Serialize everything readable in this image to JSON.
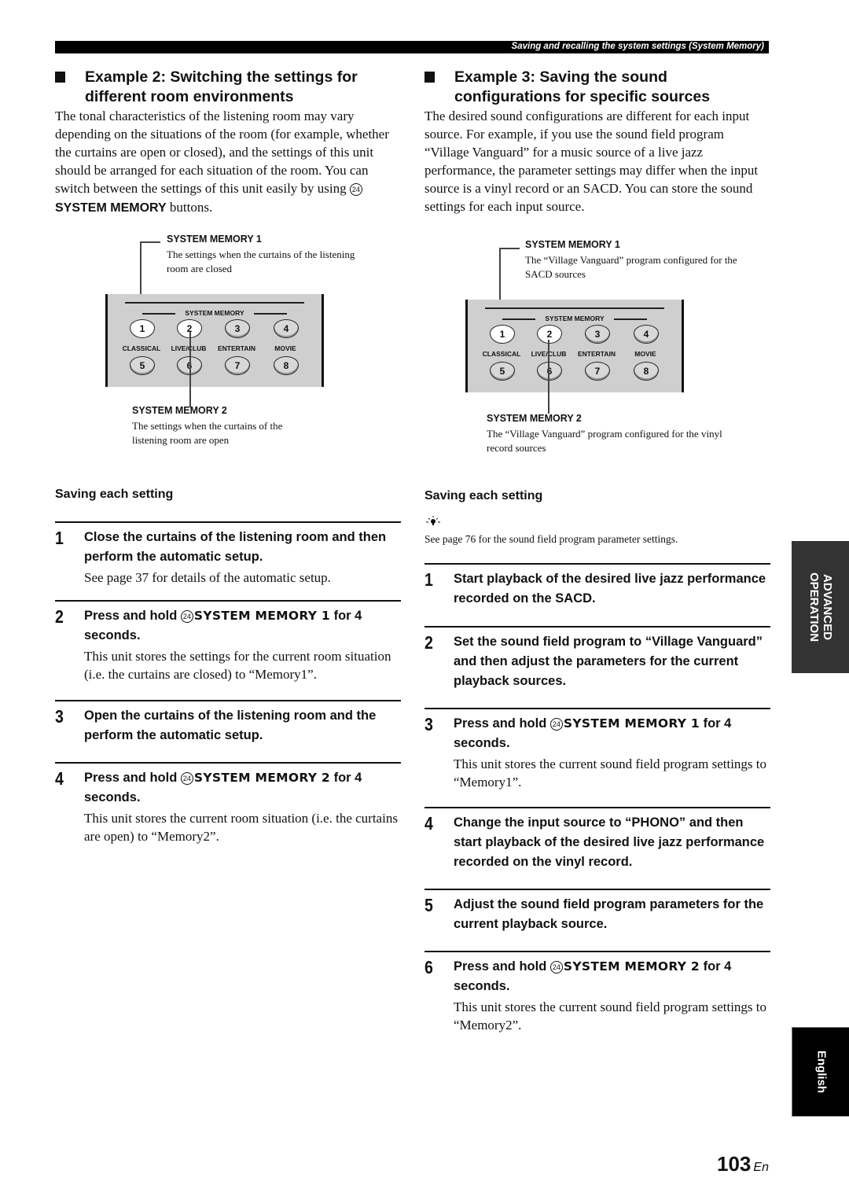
{
  "header": {
    "title": "Saving and recalling the system settings (System Memory)"
  },
  "left": {
    "heading_line1": "Example 2: Switching the settings for",
    "heading_line2": "different room environments",
    "intro_text": "The tonal characteristics of the listening room may vary depending on the situations of the room (for example, whether the curtains are open or closed), and the settings of this unit should be arranged for each situation of the room. You can switch between the settings of this unit easily by using ",
    "intro_button_ref": "24",
    "intro_bold": "SYSTEM MEMORY",
    "intro_tail": " buttons.",
    "diagram": {
      "callout1_title": "SYSTEM MEMORY 1",
      "callout1_desc": "The settings when the curtains of the listening room are closed",
      "callout2_title": "SYSTEM MEMORY 2",
      "callout2_desc": "The settings when the curtains of the listening room are open"
    },
    "subheading": "Saving each setting",
    "steps": [
      {
        "num": "1",
        "title": "Close the curtains of the listening room and then perform the automatic setup.",
        "body": "See page 37 for details of the automatic setup."
      },
      {
        "num": "2",
        "title_pre": "Press and hold ",
        "ref": "24",
        "key": "SYSTEM MEMORY 1",
        "title_post": " for 4 seconds.",
        "body": "This unit stores the settings for the current room situation (i.e. the curtains are closed) to “Memory1”."
      },
      {
        "num": "3",
        "title": "Open the curtains of the listening room and the perform the automatic setup."
      },
      {
        "num": "4",
        "title_pre": "Press and hold ",
        "ref": "24",
        "key": "SYSTEM MEMORY 2",
        "title_post": " for 4 seconds.",
        "body": "This unit stores the current room situation (i.e. the curtains are open) to “Memory2”."
      }
    ]
  },
  "right": {
    "heading_line1": "Example 3: Saving the sound",
    "heading_line2": "configurations for specific sources",
    "intro_text": "The desired sound configurations are different for each input source. For example, if you use the sound field program “Village Vanguard” for a music source of a live jazz performance, the parameter settings may differ when the input source is a vinyl record or an SACD. You can store the sound settings for each input source.",
    "diagram": {
      "callout1_title": "SYSTEM MEMORY 1",
      "callout1_desc": "The “Village Vanguard” program configured for the SACD sources",
      "callout2_title": "SYSTEM MEMORY 2",
      "callout2_desc": "The “Village Vanguard” program configured for the vinyl record sources"
    },
    "subheading": "Saving each setting",
    "tip_icon": "lightbulb-tip-icon",
    "tip_text": "See page 76 for the sound field program parameter settings.",
    "steps": [
      {
        "num": "1",
        "title": "Start playback of the desired live jazz performance recorded on the SACD."
      },
      {
        "num": "2",
        "title": "Set the sound field program to “Village Vanguard” and then adjust the parameters for the current playback sources."
      },
      {
        "num": "3",
        "title_pre": "Press and hold ",
        "ref": "24",
        "key": "SYSTEM MEMORY 1",
        "title_post": " for 4 seconds.",
        "body": "This unit stores the current sound field program settings to “Memory1”."
      },
      {
        "num": "4",
        "title": "Change the input source to “PHONO” and then start playback of the desired live jazz performance recorded on the vinyl record."
      },
      {
        "num": "5",
        "title": "Adjust the sound field program parameters for the current playback source."
      },
      {
        "num": "6",
        "title_pre": "Press and hold ",
        "ref": "24",
        "key": "SYSTEM MEMORY 2",
        "title_post": " for 4 seconds.",
        "body": "This unit stores the current sound field program settings to “Memory2”."
      }
    ]
  },
  "remote_panel": {
    "group_label": "SYSTEM MEMORY",
    "row1": [
      "1",
      "2",
      "3",
      "4"
    ],
    "captions": [
      "CLASSICAL",
      "LIVE/CLUB",
      "ENTERTAIN",
      "MOVIE"
    ],
    "row2": [
      "5",
      "6",
      "7",
      "8"
    ],
    "highlighted": [
      "1",
      "2"
    ]
  },
  "side_tabs": {
    "section_line1": "ADVANCED",
    "section_line2": "OPERATION",
    "language": "English"
  },
  "footer": {
    "page_number": "103",
    "lang_suffix": "En"
  }
}
